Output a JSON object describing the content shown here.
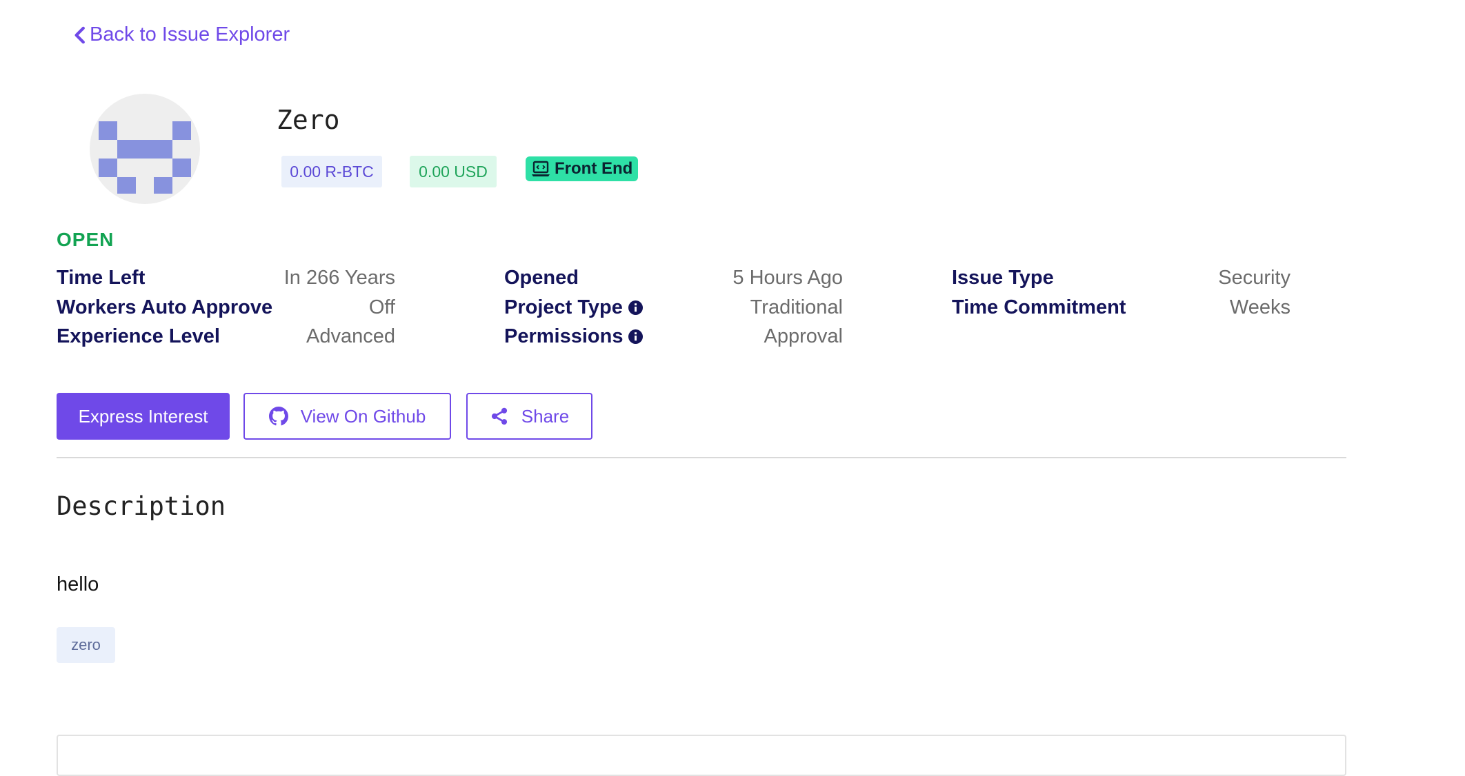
{
  "nav": {
    "back_label": "Back to Issue Explorer"
  },
  "issue": {
    "title": "Zero",
    "amount_rbtc": "0.00 R-BTC",
    "amount_usd": "0.00 USD",
    "category": "Front End",
    "status": "OPEN"
  },
  "details": {
    "time_left_label": "Time Left",
    "time_left_value": "In 266 Years",
    "workers_auto_approve_label": "Workers Auto Approve",
    "workers_auto_approve_value": "Off",
    "experience_level_label": "Experience Level",
    "experience_level_value": "Advanced",
    "opened_label": "Opened",
    "opened_value": "5 Hours Ago",
    "project_type_label": "Project Type",
    "project_type_value": "Traditional",
    "permissions_label": "Permissions",
    "permissions_value": "Approval",
    "issue_type_label": "Issue Type",
    "issue_type_value": "Security",
    "time_commitment_label": "Time Commitment",
    "time_commitment_value": "Weeks"
  },
  "actions": {
    "express_interest": "Express Interest",
    "view_github": "View On Github",
    "share": "Share"
  },
  "description": {
    "heading": "Description",
    "body": "hello",
    "tags": [
      "zero"
    ]
  },
  "icons": {
    "back": "chevron-left-icon",
    "category": "laptop-code-icon",
    "info": "info-circle-icon",
    "github": "github-icon",
    "share": "share-icon"
  },
  "colors": {
    "accent": "#6f49e8",
    "status_open": "#12a352",
    "category_badge": "#2ee0a6",
    "label_text": "#14145a",
    "avatar_identicon": "#8792de"
  }
}
